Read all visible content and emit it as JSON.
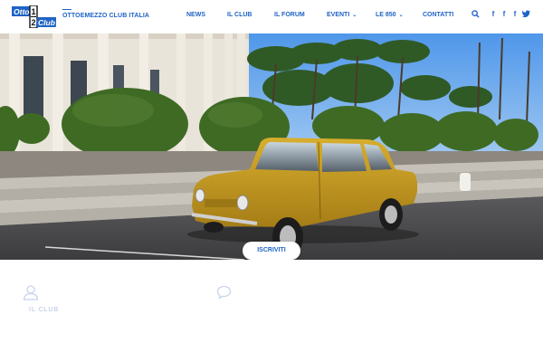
{
  "brand": {
    "logo_top": "Otto",
    "logo_num_top": "1",
    "logo_num_bottom": "2",
    "logo_bottom": "Club",
    "site_title": "OTTOEMEZZO CLUB ITALIA"
  },
  "nav": {
    "items": [
      {
        "label": "NEWS"
      },
      {
        "label": "IL CLUB"
      },
      {
        "label": "IL FORUM"
      },
      {
        "label": "EVENTI"
      },
      {
        "label": "LE 850"
      },
      {
        "label": "CONTATTI"
      }
    ]
  },
  "header_icons": [
    "search-icon",
    "facebook-icon",
    "facebook-icon",
    "facebook-icon",
    "twitter-icon"
  ],
  "hero": {
    "cta_label": "ISCRIVITI"
  },
  "features": {
    "club_label": "IL CLUB"
  },
  "colors": {
    "brand_blue": "#1f63c6",
    "car_yellow": "#c69a1f"
  }
}
